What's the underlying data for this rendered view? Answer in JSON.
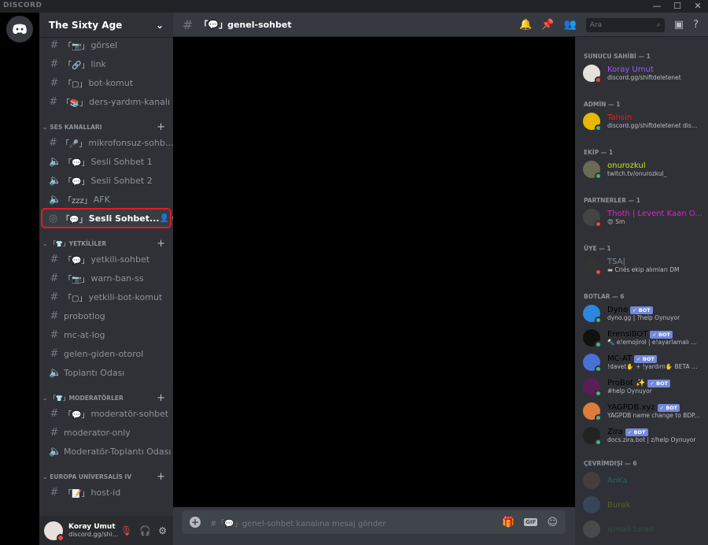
{
  "window": {
    "brand": "DISCORD",
    "minimize": "—",
    "maximize": "☐",
    "close": "✕"
  },
  "server": {
    "name": "The Sixty Age",
    "chevron": "⌄"
  },
  "channels_top": [
    {
      "emoji": "「📷」",
      "name": "görsel",
      "type": "text"
    },
    {
      "emoji": "「🔗」",
      "name": "link",
      "type": "text"
    },
    {
      "emoji": "「▢」",
      "name": "bot-komut",
      "type": "text"
    },
    {
      "emoji": "「📚」",
      "name": "ders-yardım-kanalı",
      "type": "text"
    }
  ],
  "categories": [
    {
      "name": "SES KANALLARI",
      "channels": [
        {
          "emoji": "「🎤」",
          "name": "mikrofonsuz-sohb...",
          "type": "text"
        },
        {
          "emoji": "「💬」",
          "name": "Sesli Sohbet 1",
          "type": "voice"
        },
        {
          "emoji": "「💬」",
          "name": "Sesli Sohbet 2",
          "type": "voice"
        },
        {
          "emoji": "「zzz」",
          "name": "AFK",
          "type": "voice"
        },
        {
          "emoji": "「💬」",
          "name": "Sesli Sohbet...",
          "type": "stage",
          "selected": true
        }
      ]
    },
    {
      "name": "「👕」YETKİLİLER",
      "channels": [
        {
          "emoji": "「💬」",
          "name": "yetkili-sohbet",
          "type": "text"
        },
        {
          "emoji": "「📷」",
          "name": "warn-ban-ss",
          "type": "text"
        },
        {
          "emoji": "「▢」",
          "name": "yetkili-bot-komut",
          "type": "text"
        },
        {
          "emoji": "",
          "name": "probotlog",
          "type": "text"
        },
        {
          "emoji": "",
          "name": "mc-at-log",
          "type": "text"
        },
        {
          "emoji": "",
          "name": "gelen-giden-otorol",
          "type": "text"
        },
        {
          "emoji": "",
          "name": "Toplantı Odası",
          "type": "voice"
        }
      ]
    },
    {
      "name": "「👕」MODERATÖRLER",
      "channels": [
        {
          "emoji": "「💬」",
          "name": "moderatör-sohbet",
          "type": "text"
        },
        {
          "emoji": "",
          "name": "moderator-only",
          "type": "text"
        },
        {
          "emoji": "",
          "name": "Moderatör-Toplantı Odası",
          "type": "voice"
        }
      ]
    },
    {
      "name": "EUROPA UNİVERSALİS IV",
      "channels": [
        {
          "emoji": "「📝」",
          "name": "host-id",
          "type": "text"
        }
      ]
    }
  ],
  "user_panel": {
    "name": "Koray Umut",
    "status": "discord.gg/shi..."
  },
  "header": {
    "channel": "「💬」genel-sohbet",
    "search_placeholder": "Ara"
  },
  "composer": {
    "placeholder": "#「💬」genel-sohbet kanalına mesaj gönder",
    "gif": "GIF"
  },
  "members": [
    {
      "category": "SUNUCU SAHİBİ — 1",
      "items": [
        {
          "name": "Koray Umut",
          "sub": "discord.gg/shiftdeletenet",
          "color": "#9b59ff",
          "status": "dnd",
          "avatar": "#e8e0da"
        }
      ]
    },
    {
      "category": "ADMİN — 1",
      "items": [
        {
          "name": "Tahsin",
          "sub": "discord.gg/shiftdeletenet disc...",
          "color": "#e91e1e",
          "status": "online",
          "avatar": "#e8b800"
        }
      ]
    },
    {
      "category": "EKİP — 1",
      "items": [
        {
          "name": "onurozkul",
          "sub": "twitch.tv/onurozkul_",
          "color": "#c8e61b",
          "status": "online",
          "avatar": "#6b6a55"
        }
      ]
    },
    {
      "category": "PARTNERLER — 1",
      "items": [
        {
          "name": "Thoth | Levent Kaan O...",
          "sub": "😍 Sm",
          "color": "#e91ecf",
          "status": "dnd",
          "avatar": "#444"
        }
      ]
    },
    {
      "category": "ÜYE — 1",
      "items": [
        {
          "name": "TSA|",
          "sub": "▬ Criés ekip alımları DM",
          "color": "#7f8c9d",
          "status": "dnd",
          "avatar": "#333"
        }
      ]
    },
    {
      "category": "BOTLAR — 6",
      "items": [
        {
          "name": "Dyno",
          "bot": "✓ BOT",
          "sub": "dyno.gg | ?help Oynuyor",
          "color": "#000",
          "status": "online",
          "avatar": "#2c87e0"
        },
        {
          "name": "ErensiBOT",
          "bot": "✓ BOT",
          "sub": "🔦 e!emojirol | e!ayarlamalı Oy...",
          "color": "#000",
          "status": "online",
          "avatar": "#111"
        },
        {
          "name": "MC-AT",
          "bot": "✓ BOT",
          "sub": "!davet✋ + !yardım✋ BETA O...",
          "color": "#000",
          "status": "online",
          "avatar": "#4a6fd6"
        },
        {
          "name": "ProBot ✨",
          "bot": "✓ BOT",
          "sub": "#help Oynuyor",
          "color": "#000",
          "status": "online",
          "avatar": "#5b1d55"
        },
        {
          "name": "YAGPDB.xyz",
          "bot": "✓ BOT",
          "sub": "YAGPDB name change to BDP...",
          "color": "#000",
          "status": "online",
          "avatar": "#e07b39"
        },
        {
          "name": "Zira",
          "bot": "✓ BOT",
          "sub": "docs.zira.bot | z/help Oynuyor",
          "color": "#000",
          "status": "online",
          "avatar": "#222"
        }
      ]
    },
    {
      "category": "ÇEVRİMDIŞI — 6",
      "items": [
        {
          "name": "AnKa",
          "color": "#1abc9c",
          "status": "",
          "avatar": "#6a5a50"
        },
        {
          "name": "Burak",
          "color": "#a8b51b",
          "status": "",
          "avatar": "#4a6a9a"
        },
        {
          "name": "ismail turan",
          "color": "#2e8b57",
          "status": "",
          "avatar": "#777"
        }
      ]
    }
  ]
}
